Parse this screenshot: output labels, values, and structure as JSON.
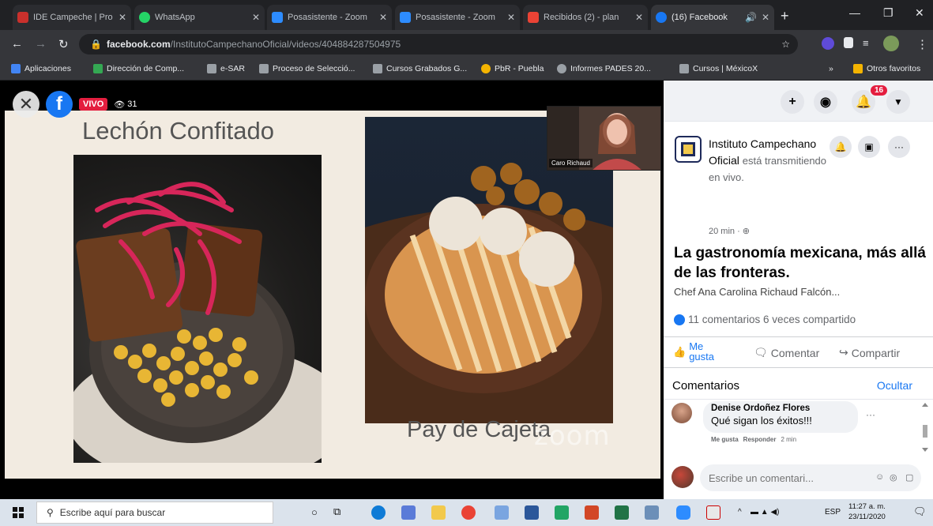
{
  "browser": {
    "tabs": [
      {
        "title": "IDE Campeche | Pro",
        "color": "#c9302c"
      },
      {
        "title": "WhatsApp",
        "color": "#25d366"
      },
      {
        "title": "Posasistente - Zoom",
        "color": "#2d8cff"
      },
      {
        "title": "Posasistente - Zoom",
        "color": "#2d8cff"
      },
      {
        "title": "Recibidos (2) - plan",
        "color": "#ea4335"
      },
      {
        "title": "(16) Facebook",
        "color": "#1877f2"
      }
    ],
    "url_domain": "facebook.com",
    "url_path": "/InstitutoCampechanoOficial/videos/404884287504975",
    "bookmarks": [
      {
        "label": "Aplicaciones",
        "color": "#4285f4"
      },
      {
        "label": "Dirección de Comp...",
        "color": "#34a853"
      },
      {
        "label": "e-SAR",
        "color": "#9aa0a6"
      },
      {
        "label": "Proceso de Selecció...",
        "color": "#9aa0a6"
      },
      {
        "label": "Cursos Grabados G...",
        "color": "#9aa0a6"
      },
      {
        "label": "PbR - Puebla",
        "color": "#f4b400"
      },
      {
        "label": "Informes PADES 20...",
        "color": "#9aa0a6"
      },
      {
        "label": "Cursos | MéxicoX",
        "color": "#9aa0a6"
      },
      {
        "label": "Otros favoritos",
        "color": "#f4b400"
      }
    ]
  },
  "video": {
    "live_label": "VIVO",
    "viewer_count": "31",
    "slide_title": "Lechón Confitado",
    "slide_caption": "Pay de Cajeta",
    "watermark": "zoom",
    "pip_name": "Caro Richaud",
    "facebook_glyph": "f"
  },
  "panel": {
    "notification_count": "16",
    "page_name": "Instituto Campechano Oficial",
    "status_text": "está transmitiendo en vivo.",
    "time_ago": "20 min · ",
    "headline": "La gastronomía mexicana, más allá de las fronteras.",
    "presenter": "Chef Ana Carolina Richaud Falcón...",
    "stats": "11 comentarios 6 veces compartido",
    "like_label": "Me gusta",
    "comment_label": "Comentar",
    "share_label": "Compartir",
    "comments_title": "Comentarios",
    "hide_label": "Ocultar",
    "comment": {
      "author": "Denise Ordoñez Flores",
      "text": "Qué sigan los éxitos!!!",
      "like": "Me gusta",
      "reply": "Responder",
      "age": "2 min"
    },
    "compose_placeholder": "Escribe un comentari..."
  },
  "taskbar": {
    "search_placeholder": "Escribe aquí para buscar",
    "lang": "ESP",
    "time": "11:27 a. m.",
    "date": "23/11/2020"
  },
  "colors": {
    "facebook_blue": "#1877f2",
    "live_red": "#e41e3f"
  }
}
